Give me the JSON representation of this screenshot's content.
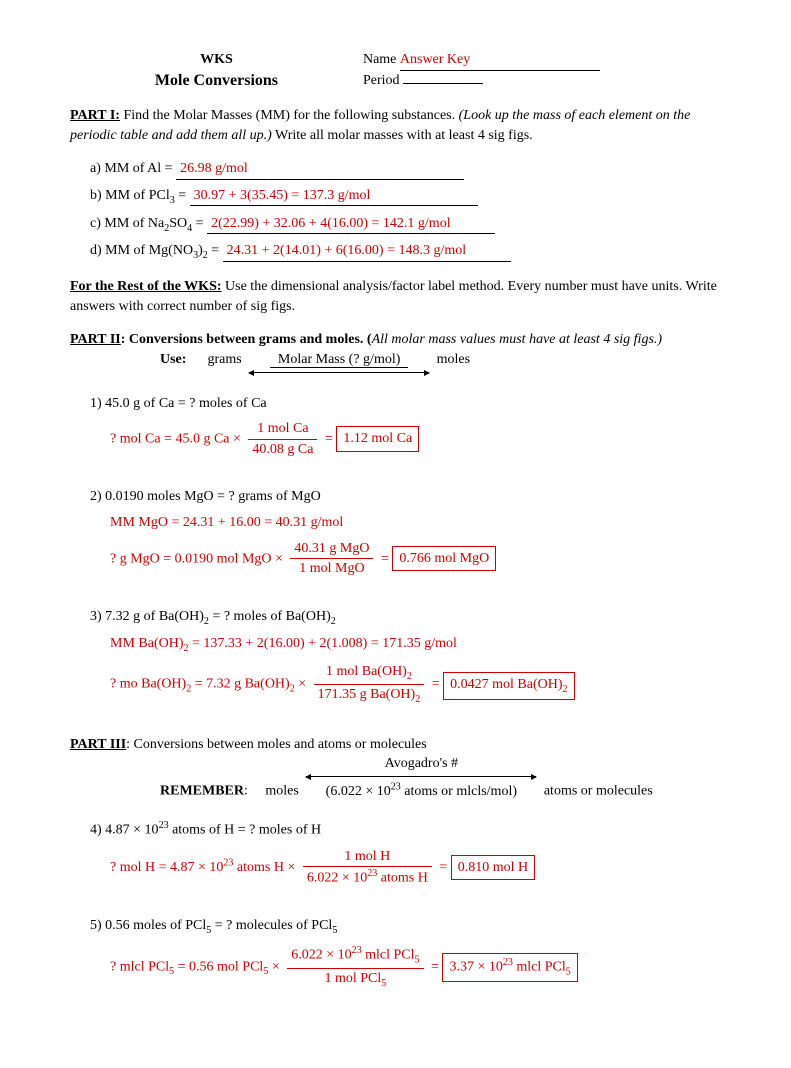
{
  "header": {
    "wks": "WKS",
    "title": "Mole Conversions",
    "name_label": "Name",
    "name_value": "Answer Key",
    "period_label": "Period"
  },
  "part1": {
    "heading": "PART I:",
    "text1": " Find the Molar Masses (MM) for the following substances.  ",
    "text2": "(Look up the mass of each element on the periodic table and add them all up.)",
    "text3": " Write all molar masses with at least 4 sig figs.",
    "a_label": "a)   MM of Al = ",
    "a_ans": "26.98 g/mol",
    "b_label": "b)   MM of PCl",
    "b_sub": "3",
    "b_label2": " = ",
    "b_ans": "30.97 + 3(35.45) = 137.3 g/mol",
    "c_label": "c)   MM of Na",
    "c_sub1": "2",
    "c_label2": "SO",
    "c_sub2": "4",
    "c_label3": " = ",
    "c_ans": "2(22.99) + 32.06 + 4(16.00) = 142.1 g/mol",
    "d_label": "d)   MM of Mg(NO",
    "d_sub1": "3",
    "d_label2": ")",
    "d_sub2": "2",
    "d_label3": " = ",
    "d_ans": "24.31 + 2(14.01) + 6(16.00) = 148.3 g/mol"
  },
  "rest": {
    "heading": "For the Rest of the WKS:",
    "text": "  Use the dimensional analysis/factor label method.  Every number must have units.  Write answers with correct number of sig figs."
  },
  "part2": {
    "heading": "PART II",
    "heading2": ": Conversions between grams and moles.  (",
    "heading3": "All molar mass values must have at least 4 sig figs.)",
    "use": "Use:",
    "grams": "grams",
    "arrow_top": "Molar Mass (? g/mol)",
    "moles": "moles"
  },
  "q1": {
    "q": "1)   45.0 g of Ca  = ?  moles of Ca",
    "lhs": "?  mol Ca = 45.0 g Ca ×",
    "num": "1 mol Ca",
    "den": "40.08 g Ca",
    "eq": " = ",
    "ans": "1.12 mol Ca"
  },
  "q2": {
    "q": "2)   0.0190 moles MgO  =   ? grams of MgO",
    "mm": "MM MgO = 24.31 + 16.00 = 40.31 g/mol",
    "lhs": "?  g MgO = 0.0190 mol MgO ×",
    "num": "40.31 g MgO",
    "den": "1 mol MgO",
    "eq": " = ",
    "ans": "0.766 mol MgO"
  },
  "q3": {
    "q_a": "3)   7.32 g of Ba(OH)",
    "q_sub": "2",
    "q_b": " = ?  moles of Ba(OH)",
    "mm_a": "MM Ba(OH)",
    "mm_b": " = 137.33 + 2(16.00) + 2(1.008) = 171.35 g/mol",
    "lhs_a": "?  mo Ba(OH)",
    "lhs_b": " = 7.32 g Ba(OH)",
    "lhs_c": " ×",
    "num_a": "1 mol Ba(OH)",
    "den_a": "171.35 g Ba(OH)",
    "eq": " = ",
    "ans_a": "0.0427 mol Ba(OH)"
  },
  "part3": {
    "heading": "PART III",
    "heading2": ": Conversions between moles and atoms or molecules",
    "remember": "REMEMBER",
    "moles": "moles",
    "arrow_top": "Avogadro's #",
    "arrow_bot_a": "(6.022 × 10",
    "arrow_bot_sup": "23",
    "arrow_bot_b": "  atoms or mlcls/mol)",
    "rhs": "atoms or molecules"
  },
  "q4": {
    "q_a": "4)   4.87 × 10",
    "q_sup": "23",
    "q_b": " atoms of H = ?  moles of H",
    "lhs_a": "?  mol H = 4.87 × 10",
    "lhs_b": "  atoms H ×",
    "num": "1 mol H",
    "den_a": "6.022 × 10",
    "den_b": "  atoms H",
    "eq": " = ",
    "ans": "0.810 mol H"
  },
  "q5": {
    "q_a": "5)   0.56 moles of PCl",
    "q_sub": "5",
    "q_b": " = ?  molecules of PCl",
    "lhs_a": "?  mlcl PCl",
    "lhs_b": " = 0.56 mol PCl",
    "lhs_c": " ×",
    "num_a": "6.022 × 10",
    "num_b": "  mlcl PCl",
    "den_a": "1 mol PCl",
    "eq": " = ",
    "ans_a": "3.37 × 10",
    "ans_b": "  mlcl PCl"
  }
}
